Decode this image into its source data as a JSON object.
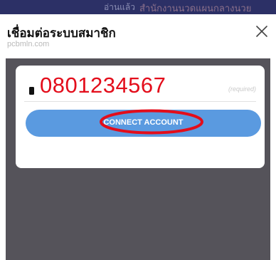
{
  "background_strip": {
    "ghost_left": "อ่านแล้ว",
    "ghost_right": "สำนักงานนวดแผนกลางนวย"
  },
  "dialog": {
    "title": "เชื่อมต่อระบบสมาชิก",
    "subtitle": "pcbmln.com",
    "close_icon": "close-icon"
  },
  "form": {
    "phone_value": "0801234567",
    "phone_icon": "phone-icon",
    "required_label": "(required)",
    "connect_label": "CONNECT ACCOUNT"
  },
  "colors": {
    "accent_button": "#5a9ae0",
    "highlight_red": "#e30d1b",
    "overlay": "#55535a"
  }
}
